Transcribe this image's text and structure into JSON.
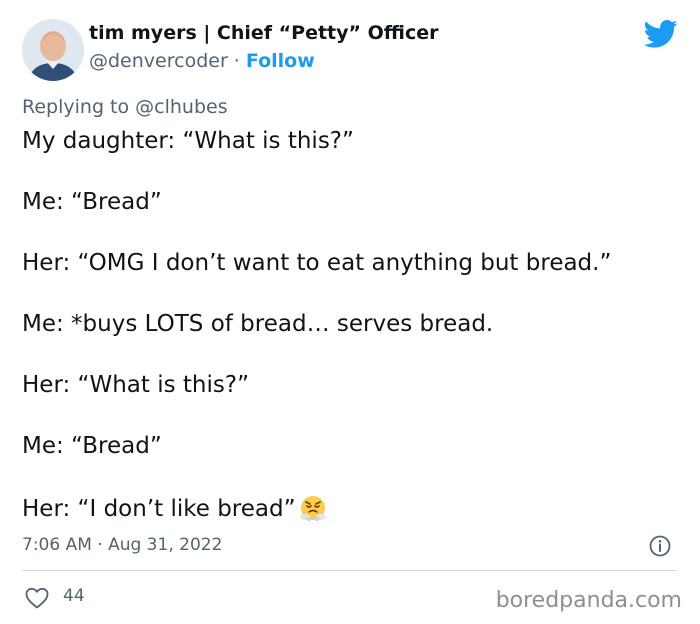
{
  "author": {
    "display_name": "tim myers | Chief “Petty” Officer",
    "handle": "@denvercoder",
    "separator": " · ",
    "follow_label": "Follow"
  },
  "reply": {
    "text": "Replying to @clhubes"
  },
  "tweet_lines": [
    "My daughter: “What is this?”",
    "Me: “Bread”",
    "Her: “OMG I don’t want to eat anything but bread.”",
    "Me: *buys LOTS of bread… serves bread.",
    "Her: “What is this?”",
    "Me: “Bread”",
    "Her: “I don’t like bread”"
  ],
  "icons": {
    "emoji": "steam-from-nose-face-emoji",
    "brand": "twitter-bird-icon",
    "info": "info-icon",
    "like": "heart-icon"
  },
  "meta": {
    "timestamp": "7:06 AM · Aug 31, 2022",
    "like_count": "44"
  },
  "watermark": "boredpanda.com",
  "colors": {
    "brand_blue": "#1d9bf0",
    "text_primary": "#0f1419",
    "text_secondary": "#536471",
    "divider": "#cfd9de"
  }
}
